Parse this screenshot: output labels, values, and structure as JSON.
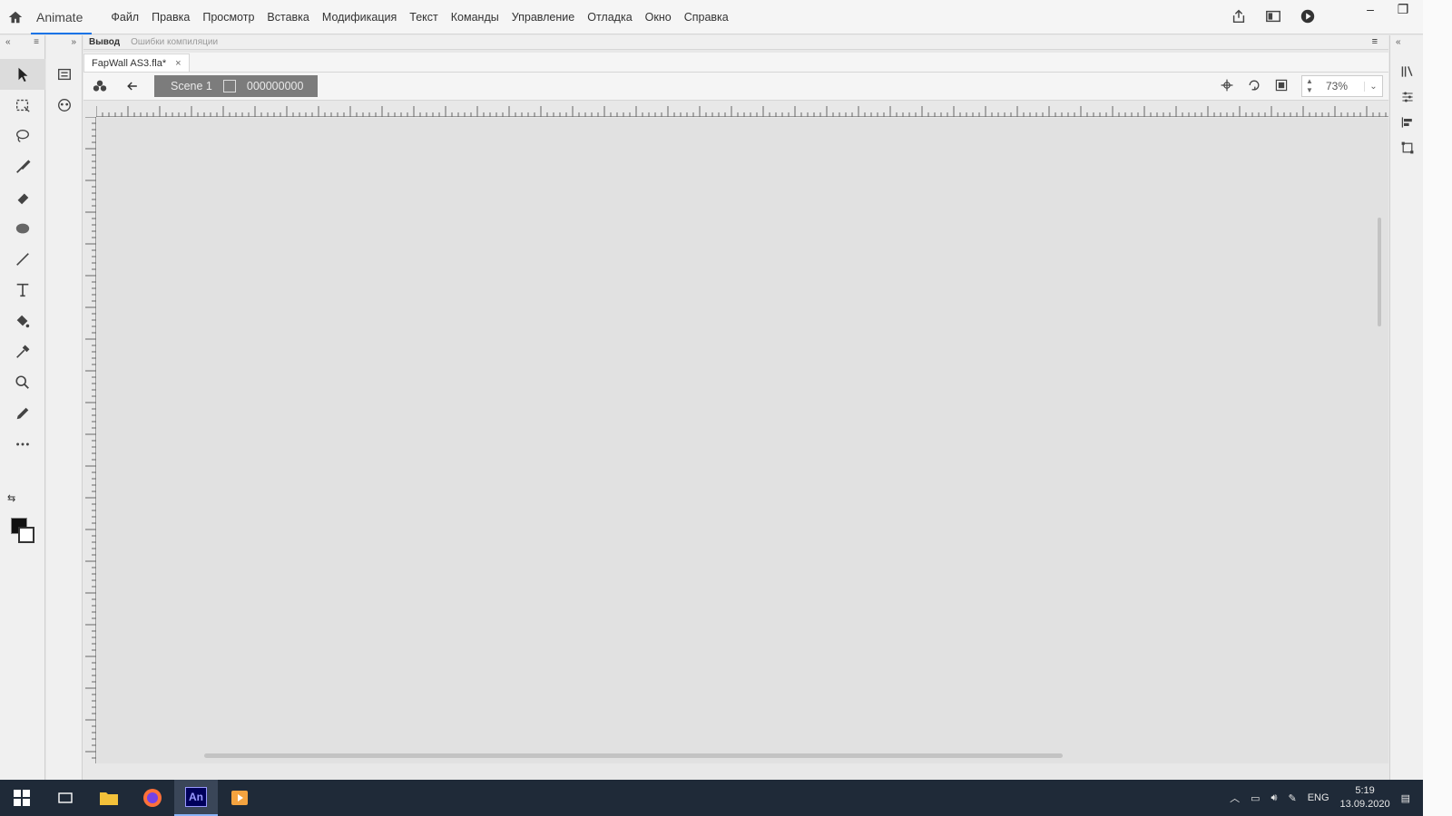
{
  "menubar": {
    "app_name": "Animate",
    "items": [
      "Файл",
      "Правка",
      "Просмотр",
      "Вставка",
      "Модификация",
      "Текст",
      "Команды",
      "Управление",
      "Отладка",
      "Окно",
      "Справка"
    ]
  },
  "panel_tabs": {
    "output": "Вывод",
    "compiler_errors": "Ошибки компиляции"
  },
  "document": {
    "tab_title": "FapWall AS3.fla*",
    "close": "×"
  },
  "editbar": {
    "scene": "Scene 1",
    "symbol": "000000000",
    "zoom": "73%"
  },
  "taskbar": {
    "lang": "ENG",
    "time": "5:19",
    "date": "13.09.2020"
  }
}
